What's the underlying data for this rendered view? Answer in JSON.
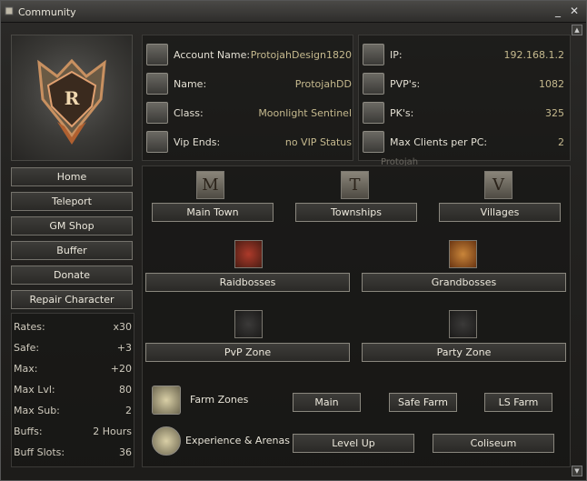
{
  "window": {
    "title": "Community",
    "minimize": "_",
    "close": "✕"
  },
  "menu": [
    {
      "label": "Home"
    },
    {
      "label": "Teleport"
    },
    {
      "label": "GM Shop"
    },
    {
      "label": "Buffer"
    },
    {
      "label": "Donate"
    },
    {
      "label": "Repair Character"
    }
  ],
  "stats": [
    {
      "label": "Rates:",
      "value": "x30"
    },
    {
      "label": "Safe:",
      "value": "+3"
    },
    {
      "label": "Max:",
      "value": "+20"
    },
    {
      "label": "Max Lvl:",
      "value": "80"
    },
    {
      "label": "Max Sub:",
      "value": "2"
    },
    {
      "label": "Buffs:",
      "value": "2 Hours"
    },
    {
      "label": "Buff Slots:",
      "value": "36"
    }
  ],
  "account": {
    "account_name_label": "Account Name:",
    "account_name": "ProtojahDesign1820",
    "name_label": "Name:",
    "name": "ProtojahDD",
    "class_label": "Class:",
    "class": "Moonlight Sentinel",
    "vip_label": "Vip Ends:",
    "vip": "no VIP Status"
  },
  "connection": {
    "ip_label": "IP:",
    "ip": "192.168.1.2",
    "pvp_label": "PVP's:",
    "pvp": "1082",
    "pk_label": "PK's:",
    "pk": "325",
    "max_clients_label": "Max Clients per PC:",
    "max_clients": "2"
  },
  "hover_text": "Protojah",
  "teleports": {
    "main_town": {
      "icon_letter": "M",
      "label": "Main Town"
    },
    "townships": {
      "icon_letter": "T",
      "label": "Townships"
    },
    "villages": {
      "icon_letter": "V",
      "label": "Villages"
    },
    "raidbosses": {
      "label": "Raidbosses"
    },
    "grandbosses": {
      "label": "Grandbosses"
    },
    "pvp_zone": {
      "label": "PvP Zone"
    },
    "party_zone": {
      "label": "Party Zone"
    }
  },
  "farm": {
    "label": "Farm Zones",
    "buttons": [
      "Main",
      "Safe Farm",
      "LS Farm"
    ]
  },
  "experience": {
    "label": "Experience & Arenas",
    "buttons": [
      "Level Up",
      "Coliseum"
    ]
  },
  "icons": {
    "account": "account-icon",
    "name": "name-icon",
    "class": "class-icon",
    "vip": "vip-icon",
    "ip": "ip-icon",
    "pvp": "pvp-icon",
    "pk": "pk-icon",
    "clients": "clients-icon"
  }
}
